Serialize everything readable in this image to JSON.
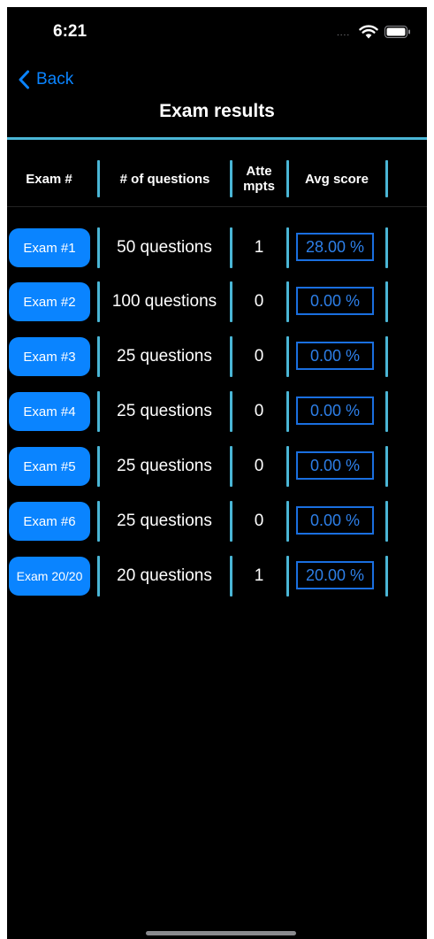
{
  "status_bar": {
    "time": "6:21",
    "signal": "....",
    "wifi_icon": "wifi-icon",
    "battery_icon": "battery-icon"
  },
  "nav": {
    "back_label": "Back",
    "title": "Exam results"
  },
  "colors": {
    "accent": "#0a84ff",
    "divider": "#4ab6d6",
    "score_border": "#1a6fe0",
    "background": "#000000"
  },
  "table": {
    "headers": {
      "exam": "Exam #",
      "questions": "# of questions",
      "attempts": "Atte\nmpts",
      "avg_score": "Avg score"
    },
    "rows": [
      {
        "exam": "Exam #1",
        "questions": "50 questions",
        "attempts": "1",
        "avg_score": "28.00 %"
      },
      {
        "exam": "Exam #2",
        "questions": "100 questions",
        "attempts": "0",
        "avg_score": "0.00 %"
      },
      {
        "exam": "Exam #3",
        "questions": "25 questions",
        "attempts": "0",
        "avg_score": "0.00 %"
      },
      {
        "exam": "Exam #4",
        "questions": "25 questions",
        "attempts": "0",
        "avg_score": "0.00 %"
      },
      {
        "exam": "Exam #5",
        "questions": "25 questions",
        "attempts": "0",
        "avg_score": "0.00 %"
      },
      {
        "exam": "Exam #6",
        "questions": "25 questions",
        "attempts": "0",
        "avg_score": "0.00 %"
      },
      {
        "exam": "Exam 20/20",
        "questions": "20 questions",
        "attempts": "1",
        "avg_score": "20.00 %"
      }
    ]
  }
}
